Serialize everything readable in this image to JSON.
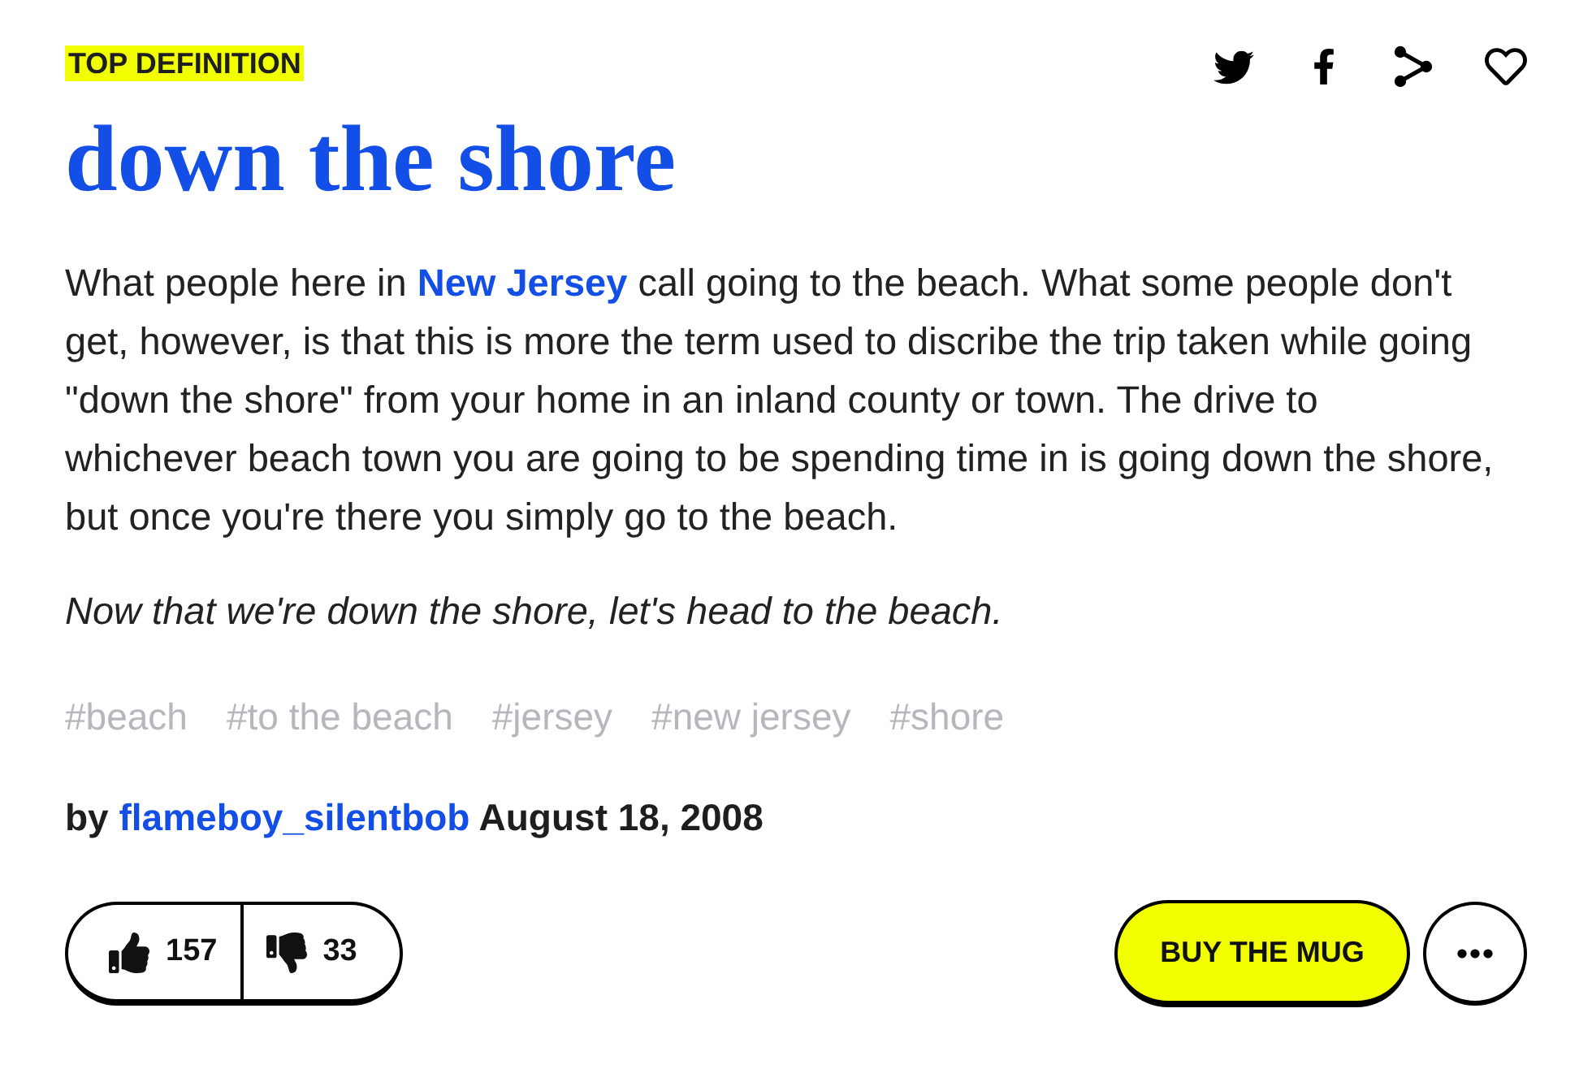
{
  "badge": "TOP DEFINITION",
  "word": "down the shore",
  "meaning": [
    {
      "kind": "text",
      "text": "What people here in "
    },
    {
      "kind": "link",
      "text": "New Jersey"
    },
    {
      "kind": "text",
      "text": " call going to the beach. What some people don't get, however, is that this is more the term used to discribe the trip taken while going \"down the shore\" from your home in an inland county or town. The drive to whichever beach town you are going to be spending time in is going down the shore, but once you're there you simply go to the beach."
    }
  ],
  "example": "Now that we're down the shore, let's head to the beach.",
  "tags": [
    "#beach",
    "#to the beach",
    "#jersey",
    "#new jersey",
    "#shore"
  ],
  "byline": {
    "prefix": "by",
    "author": "flameboy_silentbob",
    "date": "August 18, 2008"
  },
  "votes": {
    "up": "157",
    "down": "33"
  },
  "buy_button": "BUY THE MUG"
}
